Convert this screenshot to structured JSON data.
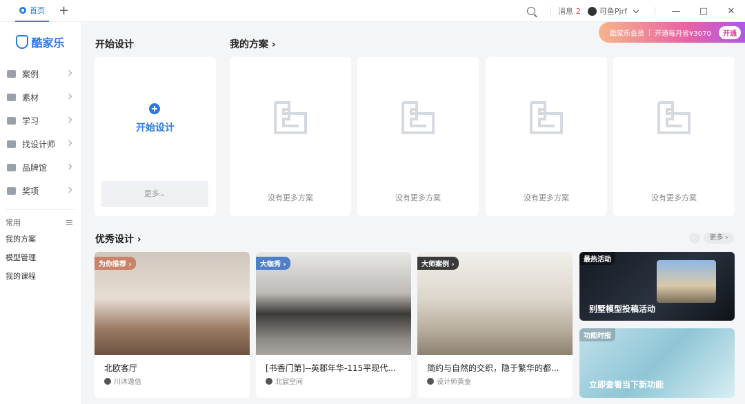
{
  "titlebar": {
    "tab_label": "首页",
    "new_tab": "+",
    "messages_label": "消息",
    "messages_count": "2",
    "username": "可鱼Pjrf",
    "minimize": "—",
    "maximize": "□",
    "close": "✕"
  },
  "promo": {
    "member": "酷家乐会员",
    "offer": "开通每月省¥3070",
    "button": "开通"
  },
  "sidebar": {
    "logo": "酷家乐",
    "items": [
      {
        "label": "案例",
        "icon": "diamond-icon"
      },
      {
        "label": "素材",
        "icon": "cube-icon"
      },
      {
        "label": "学习",
        "icon": "bar-chart-icon"
      },
      {
        "label": "找设计师",
        "icon": "id-card-icon"
      },
      {
        "label": "品牌馆",
        "icon": "heart-icon"
      },
      {
        "label": "奖项",
        "icon": "trophy-icon"
      }
    ],
    "common_label": "常用",
    "links": [
      "我的方案",
      "模型管理",
      "我的课程"
    ]
  },
  "start": {
    "section_title": "开始设计",
    "button_label": "开始设计",
    "more_label": "更多⌄"
  },
  "plans": {
    "section_title": "我的方案 ›",
    "empty_text": [
      "没有更多方案",
      "没有更多方案",
      "没有更多方案",
      "没有更多方案"
    ]
  },
  "excellent": {
    "section_title": "优秀设计 ›",
    "more_label": "更多 ›",
    "cards": [
      {
        "badge": "为你推荐 ›",
        "badge_color": "#c8836a",
        "title": "北欧客厅",
        "author": "川沐逸信"
      },
      {
        "badge": "大咖秀 ›",
        "badge_color": "#4f7fc9",
        "title": "[书香门第]--英郡年华-115平现代...",
        "author": "北宸空间"
      },
      {
        "badge": "大师案例 ›",
        "badge_color": "#3a3a3a",
        "title": "简约与自然的交织，隐于繁华的都...",
        "author": "设计师黄金"
      }
    ],
    "side": [
      {
        "tag": "最热活动",
        "text": "别墅模型投稿活动"
      },
      {
        "tag": "功能时报",
        "text": "立即查看当下新功能"
      }
    ]
  },
  "colors": {
    "accent": "#2a7ae2",
    "background": "#f4f5f7"
  }
}
